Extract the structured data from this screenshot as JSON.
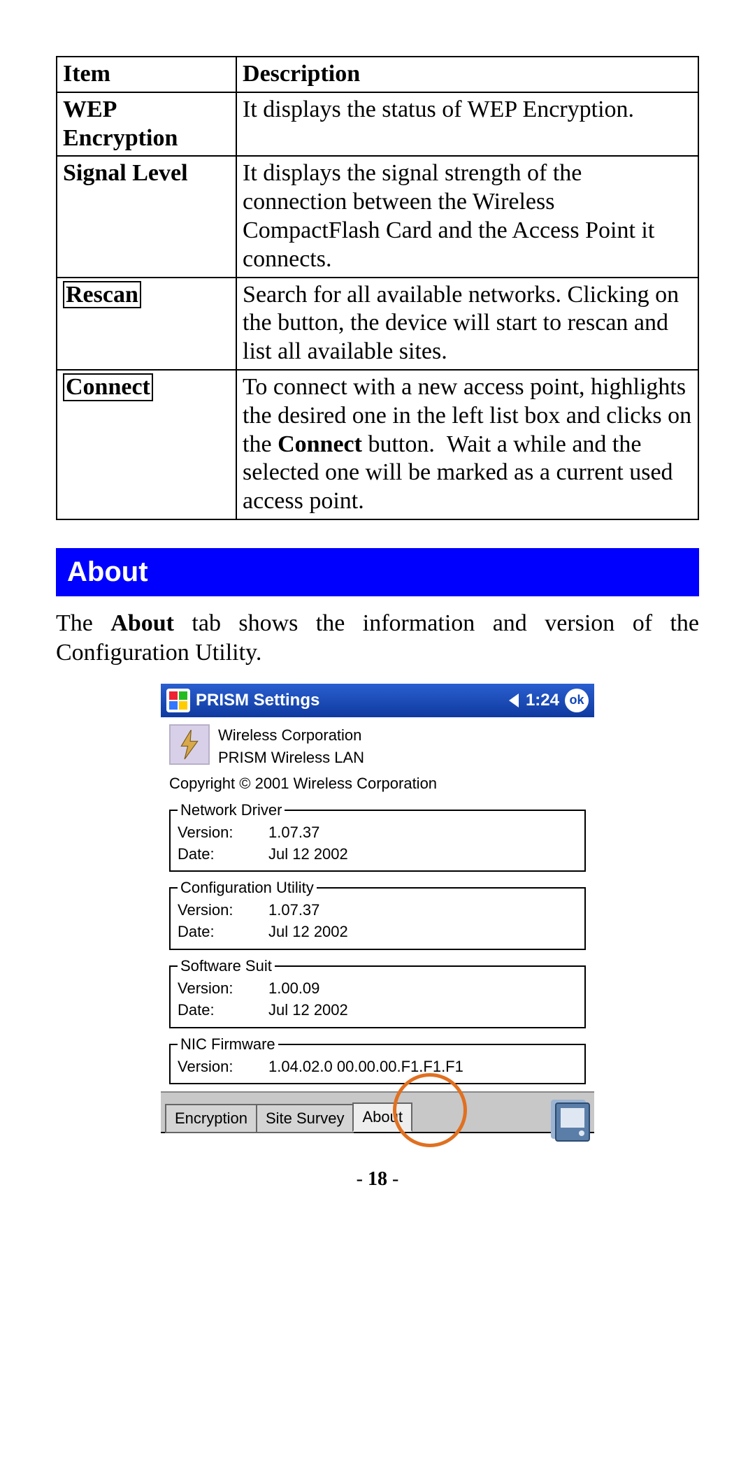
{
  "table": {
    "headers": {
      "item": "Item",
      "description": "Description"
    },
    "rows": [
      {
        "item_html": "<span class=\"bold\">WEP<br>Encryption</span>",
        "desc_html": "It displays the status of WEP Encryption."
      },
      {
        "item_html": "<span class=\"bold\">Signal Level</span>",
        "desc_html": "It displays the signal strength of the connection between the Wireless CompactFlash Card and the Access Point it connects."
      },
      {
        "item_html": "<span class=\"bold boxed\">Rescan</span>",
        "desc_html": "Search for all available networks. Clicking on the button, the device will start to rescan and list all available sites."
      },
      {
        "item_html": "<span class=\"bold boxed\">Connect</span>",
        "desc_html": "To connect with a new access point, highlights the desired one in the left list box and clicks on the <span class=\"bold\">Connect</span> button. &nbsp;Wait a while and the selected one will be marked as a current used access point."
      }
    ]
  },
  "section_title": "About",
  "section_para_html": "The <span class=\"bold\">About</span> tab shows the information and version of the Configuration Utility.",
  "screenshot": {
    "title": "PRISM Settings",
    "clock": "1:24",
    "ok": "ok",
    "company": "Wireless Corporation",
    "product": "PRISM Wireless LAN",
    "copyright": "Copyright © 2001  Wireless Corporation",
    "groups": [
      {
        "legend": "Network Driver",
        "rows": [
          {
            "k": "Version:",
            "v": "1.07.37"
          },
          {
            "k": "Date:",
            "v": "Jul 12 2002"
          }
        ]
      },
      {
        "legend": "Configuration Utility",
        "rows": [
          {
            "k": "Version:",
            "v": "1.07.37"
          },
          {
            "k": "Date:",
            "v": "Jul 12 2002"
          }
        ]
      },
      {
        "legend": "Software Suit",
        "rows": [
          {
            "k": "Version:",
            "v": "1.00.09"
          },
          {
            "k": "Date:",
            "v": "Jul 12 2002"
          }
        ]
      },
      {
        "legend": "NIC Firmware",
        "rows": [
          {
            "k": "Version:",
            "v": "1.04.02.0  00.00.00.F1.F1.F1"
          }
        ]
      }
    ],
    "tabs": [
      {
        "label": "Encryption",
        "active": false
      },
      {
        "label": "Site Survey",
        "active": false
      },
      {
        "label": "About",
        "active": true
      }
    ]
  },
  "page_number": "18"
}
